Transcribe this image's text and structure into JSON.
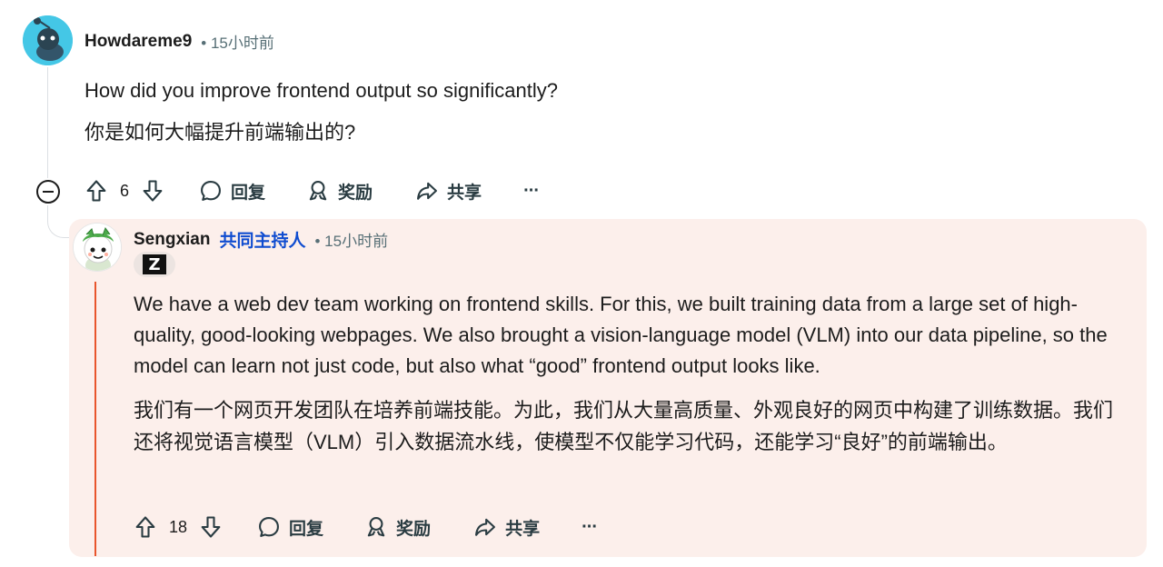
{
  "comment": {
    "username": "Howdareme9",
    "time": "• 15小时前",
    "paragraphs": [
      "How did you improve frontend output so significantly?",
      "你是如何大幅提升前端输出的?"
    ],
    "votes": "6",
    "actions": {
      "reply": "回复",
      "award": "奖励",
      "share": "共享",
      "more": "···"
    }
  },
  "reply": {
    "username": "Sengxian",
    "role": "共同主持人",
    "time": "• 15小时前",
    "flair_text": "Z",
    "paragraphs": [
      "We have a web dev team working on frontend skills. For this, we built training data from a large set of high-quality, good-looking webpages. We also brought a vision-language model (VLM) into our data pipeline, so the model can learn not just code, but also what “good” frontend output looks like.",
      "我们有一个网页开发团队在培养前端技能。为此，我们从大量高质量、外观良好的网页中构建了训练数据。我们还将视觉语言模型（VLM）引入数据流水线，使模型不仅能学习代码，还能学习“良好”的前端输出。"
    ],
    "votes": "18",
    "actions": {
      "reply": "回复",
      "award": "奖励",
      "share": "共享",
      "more": "···"
    }
  },
  "colors": {
    "avatar_bg": "#44c7e6",
    "reply_bg": "#fcefeb",
    "mod_accent": "#e8552d",
    "role_color": "#0f4cd0",
    "meta_gray": "#576f76"
  }
}
